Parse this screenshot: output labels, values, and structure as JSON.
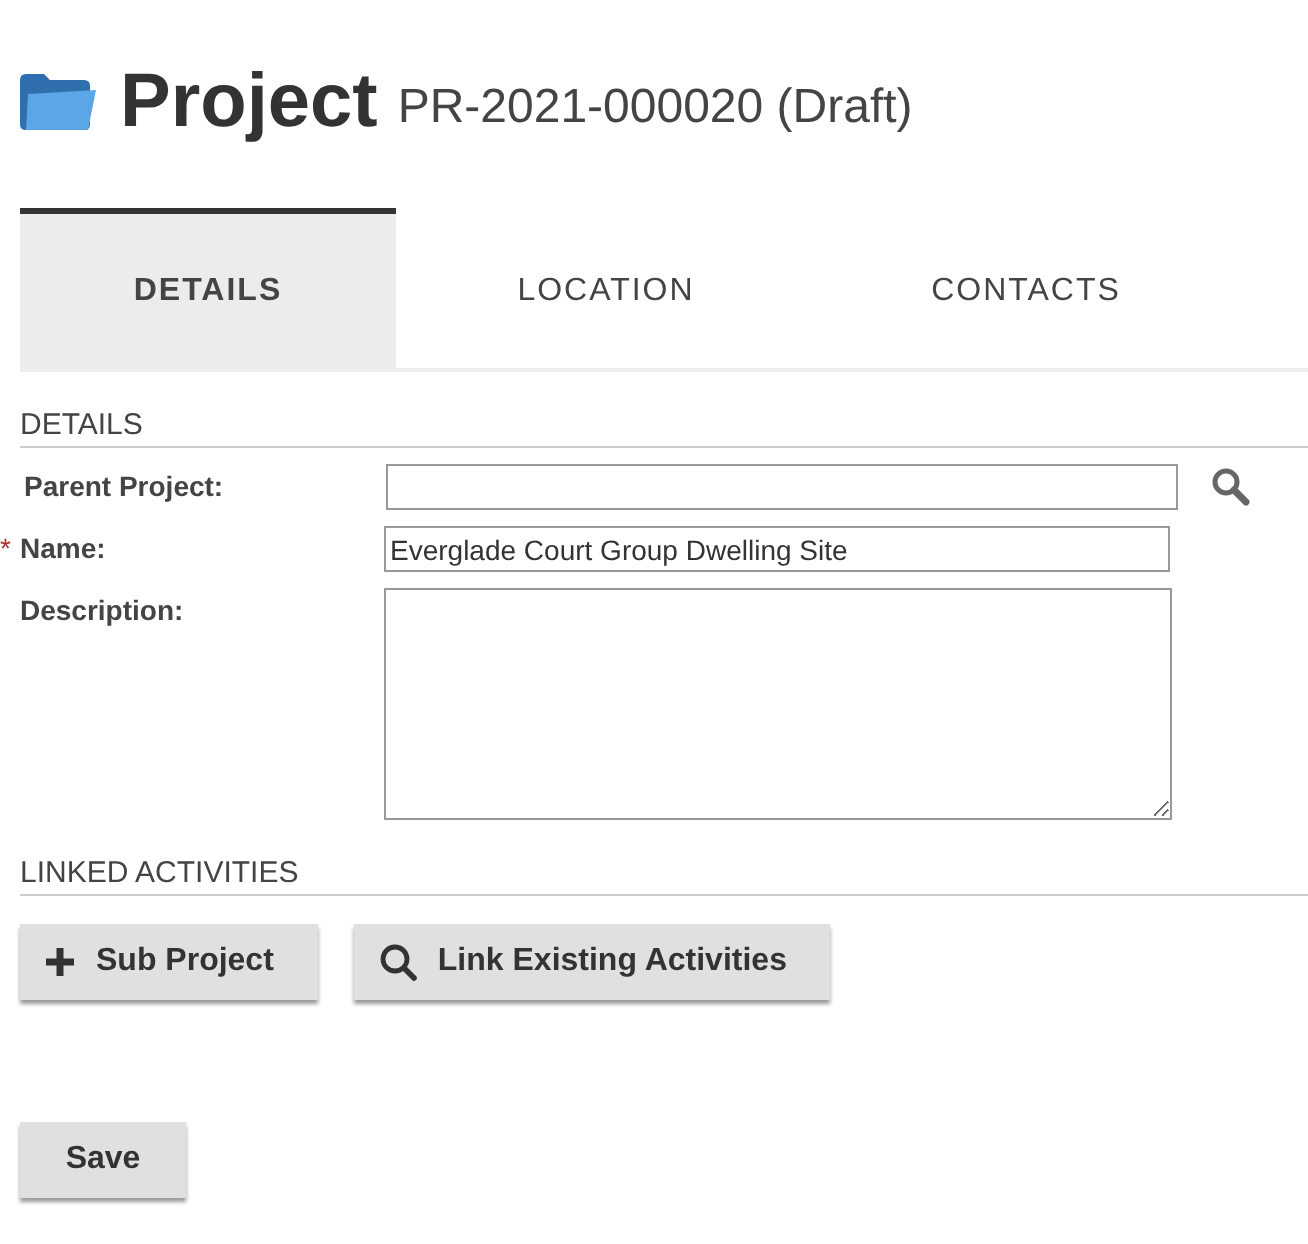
{
  "header": {
    "title": "Project",
    "subtitle": "PR-2021-000020 (Draft)"
  },
  "tabs": [
    {
      "label": "DETAILS",
      "selected": true
    },
    {
      "label": "LOCATION",
      "selected": false
    },
    {
      "label": "CONTACTS",
      "selected": false
    }
  ],
  "details": {
    "heading": "DETAILS",
    "fields": [
      {
        "kind": "lookup",
        "label": "Parent Project:",
        "required": false
      },
      {
        "kind": "text",
        "label": "Name:",
        "required": true,
        "required_mark": "*",
        "value": "Everglade Court Group Dwelling Site"
      },
      {
        "kind": "textarea",
        "label": "Description:",
        "required": false
      }
    ]
  },
  "linked_activities": {
    "heading": "LINKED ACTIVITIES",
    "buttons": [
      {
        "kind": "add",
        "label": "Sub Project"
      },
      {
        "kind": "search",
        "label": "Link Existing Activities"
      }
    ]
  },
  "save_button": "Save"
}
